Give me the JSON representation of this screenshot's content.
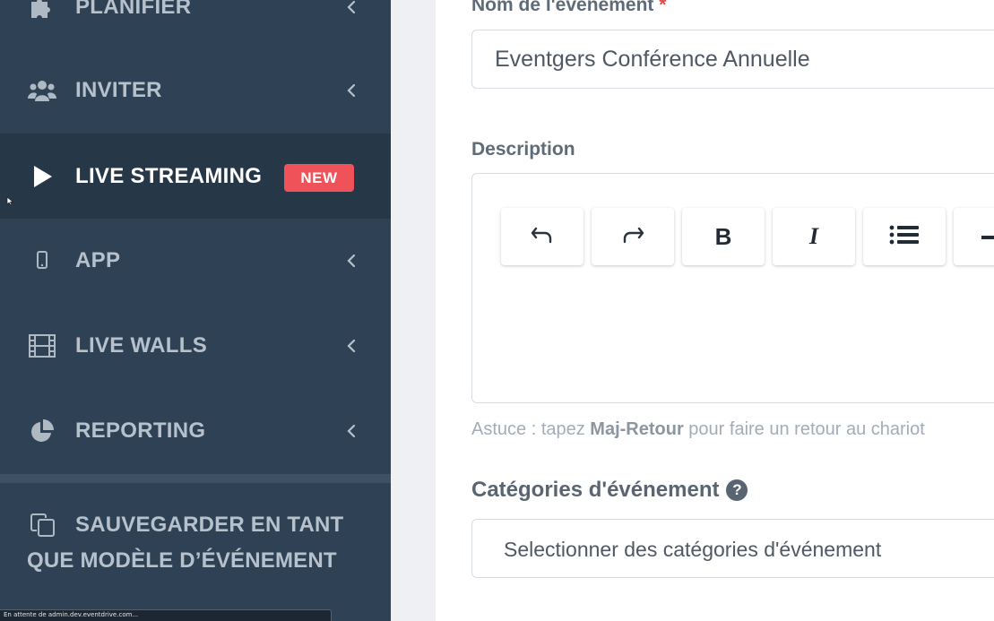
{
  "sidebar": {
    "items": [
      {
        "label": "PLANIFIER",
        "icon": "puzzle-icon"
      },
      {
        "label": "INVITER",
        "icon": "users-icon"
      },
      {
        "label": "LIVE STREAMING",
        "icon": "play-icon",
        "badge": "NEW",
        "active": true
      },
      {
        "label": "APP",
        "icon": "mobile-icon"
      },
      {
        "label": "LIVE WALLS",
        "icon": "film-icon"
      },
      {
        "label": "REPORTING",
        "icon": "pie-chart-icon"
      }
    ],
    "save_template": {
      "line1": "SAUVEGARDER EN TANT",
      "line2": "QUE MODÈLE D’ÉVÉNEMENT",
      "icon": "copy-icon"
    }
  },
  "status_bar": {
    "text": "En attente de admin.dev.eventdrive.com..."
  },
  "form": {
    "event_name": {
      "label": "Nom de l'événement",
      "required_mark": "*",
      "value": "Eventgers Conférence Annuelle"
    },
    "description": {
      "label": "Description",
      "toolbar": [
        {
          "name": "undo",
          "icon": "undo-icon"
        },
        {
          "name": "redo",
          "icon": "redo-icon"
        },
        {
          "name": "bold",
          "text": "B"
        },
        {
          "name": "italic",
          "text": "I"
        },
        {
          "name": "list",
          "icon": "list-icon"
        },
        {
          "name": "horizontal-rule",
          "icon": "minus-icon"
        }
      ],
      "hint_prefix": "Astuce : tapez ",
      "hint_key": "Maj-Retour",
      "hint_suffix": " pour faire un retour au chariot"
    },
    "categories": {
      "label": "Catégories d'événement",
      "help": "?",
      "placeholder": "Selectionner des catégories d'événement"
    }
  },
  "colors": {
    "sidebar_bg": "#2f4255",
    "sidebar_active_bg": "#263748",
    "badge_new": "#f0525a",
    "required": "#e84a4a"
  }
}
